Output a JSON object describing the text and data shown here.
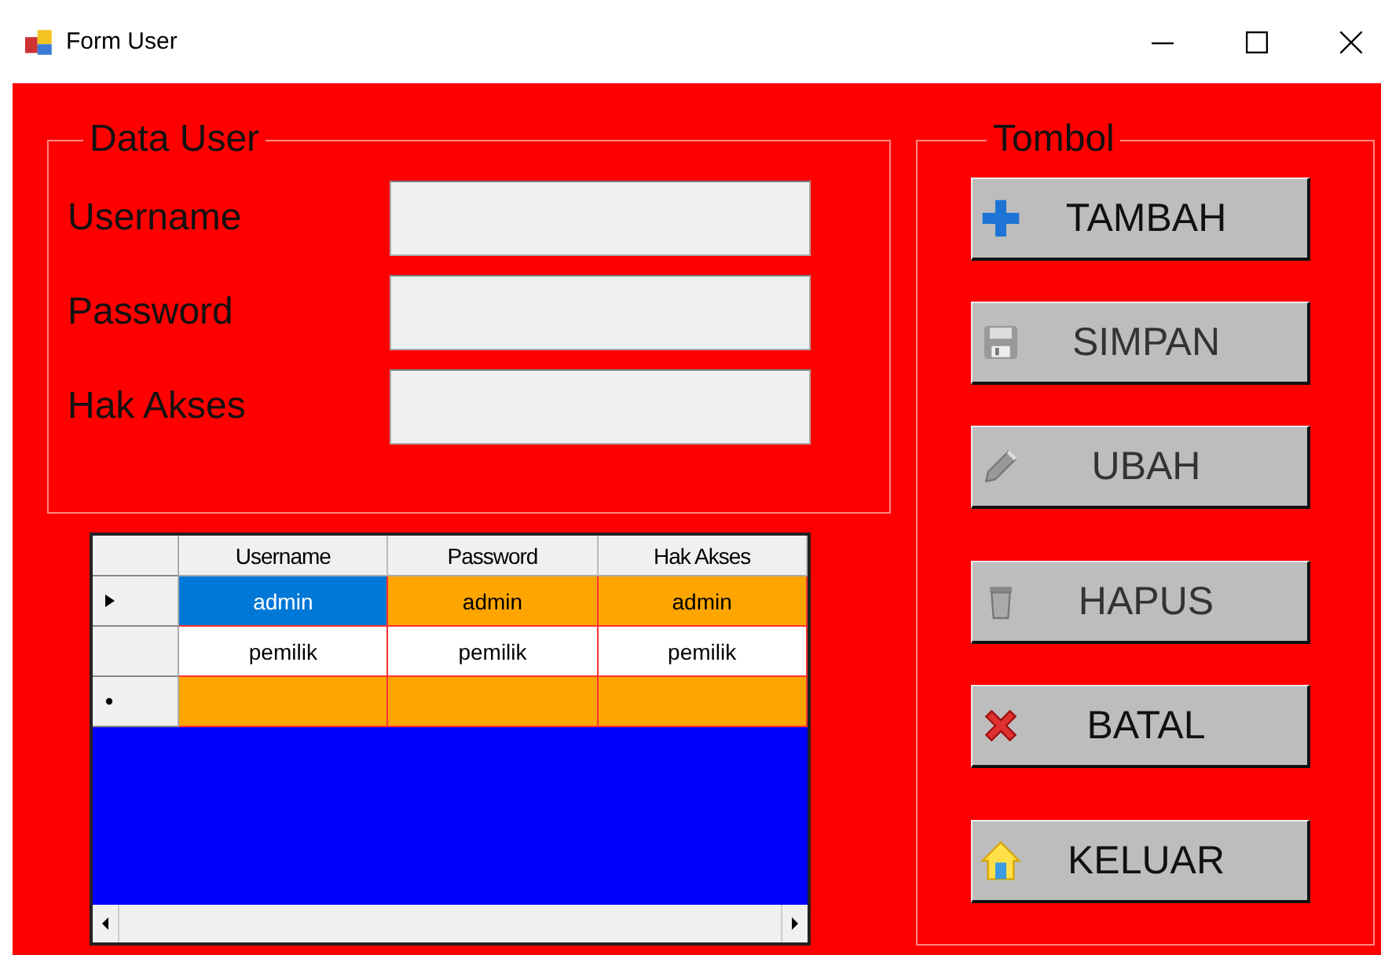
{
  "window": {
    "title": "Form User"
  },
  "data_user": {
    "title": "Data User",
    "fields": [
      {
        "label": "Username"
      },
      {
        "label": "Password"
      },
      {
        "label": "Hak Akses"
      }
    ]
  },
  "grid": {
    "columns": [
      "Username",
      "Password",
      "Hak Akses"
    ],
    "rows": [
      {
        "kind": "data",
        "current": true,
        "color": "#ffa500",
        "cells": [
          {
            "text": "admin",
            "selected": true
          },
          {
            "text": "admin",
            "selected": false
          },
          {
            "text": "admin",
            "selected": false
          }
        ]
      },
      {
        "kind": "data",
        "current": false,
        "color": "#ffffff",
        "cells": [
          {
            "text": "pemilik",
            "selected": false
          },
          {
            "text": "pemilik",
            "selected": false
          },
          {
            "text": "pemilik",
            "selected": false
          }
        ]
      },
      {
        "kind": "new",
        "current": false,
        "color": "#ffa500"
      }
    ]
  },
  "tombol": {
    "title": "Tombol",
    "buttons": [
      {
        "label": "TAMBAH",
        "kind": "add",
        "disabled": false
      },
      {
        "label": "SIMPAN",
        "kind": "save",
        "disabled": true
      },
      {
        "label": "UBAH",
        "kind": "edit",
        "disabled": true
      },
      {
        "label": "HAPUS",
        "kind": "delete",
        "disabled": true
      },
      {
        "label": "BATAL",
        "kind": "cancel",
        "disabled": false
      },
      {
        "label": "KELUAR",
        "kind": "exit",
        "disabled": false
      }
    ]
  }
}
